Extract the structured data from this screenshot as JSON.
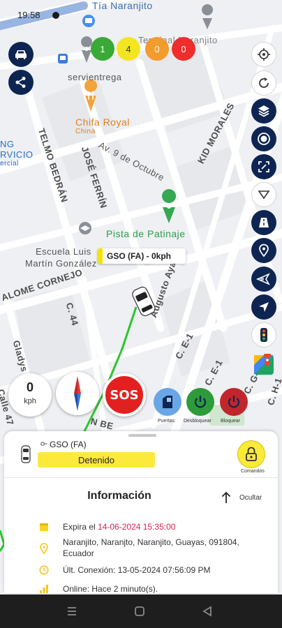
{
  "status_bar": {
    "time": "19:58"
  },
  "map": {
    "labels": {
      "tia": "Tía Naranjito",
      "terminal": "Terminal Naranjito",
      "servientrega": "servientrega",
      "chifa": "Chifa Royal",
      "china": "China",
      "kid_morales": "KID MORALES",
      "telmo": "TELMO BEDRÁN",
      "jose_ferrin": "JOSÉ FERRÍN",
      "av9": "Av. 9 de Octubre",
      "ng": "NG",
      "rvicio": "RVICIO",
      "ercial": "ercial",
      "pista": "Pista de Patinaje",
      "escuela1": "Escuela Luis",
      "escuela2": "Martín González",
      "alome": "ALOME CORNEJO",
      "c44": "C. 44",
      "ayala": "Augusto Ayala",
      "ce1": "C. E-1",
      "ce1b": "C. E-1",
      "cg1": "C. G-1",
      "ch1": "C. H-1",
      "gladys": "Gladys",
      "calle47": "Calle 47",
      "nbe": "N BE"
    }
  },
  "counters": [
    {
      "value": "1",
      "color": "#3aa935"
    },
    {
      "value": "4",
      "color": "#f3e620"
    },
    {
      "value": "0",
      "color": "#f39b2e"
    },
    {
      "value": "0",
      "color": "#ee2d2d"
    }
  ],
  "vehicle_marker": {
    "label": "GSO (FA) - 0kph"
  },
  "speedometer": {
    "value": "0",
    "unit": "kph"
  },
  "sos": {
    "label": "SOS"
  },
  "actions": {
    "doors": "Puertas",
    "unlock": "Desbloquear",
    "lock": "Bloquear"
  },
  "sheet": {
    "vehicle_name": "GSO (FA)",
    "state": "Detenido",
    "commands_label": "Comandos",
    "info_title": "Información",
    "hide_label": "Ocultar",
    "expire_prefix": "Expira el",
    "expire_date": "14-06-2024 15:35:00",
    "address_line1": "Naranjito, Naranjto, Naranjito, Guayas, 091804,",
    "address_line2": "Ecuador",
    "last_connection": "Últ. Conexión: 13-05-2024 07:56:09 PM",
    "online": "Online: Hace 2 minuto(s)."
  },
  "colors": {
    "brand_dark": "#0e2551",
    "accent_yellow": "#fbe93c",
    "sos_red": "#e32020",
    "unlock_green": "#2e9b3a",
    "lock_red": "#c0262b",
    "expire_red": "#e0204f",
    "route_green": "#2ec52e"
  }
}
